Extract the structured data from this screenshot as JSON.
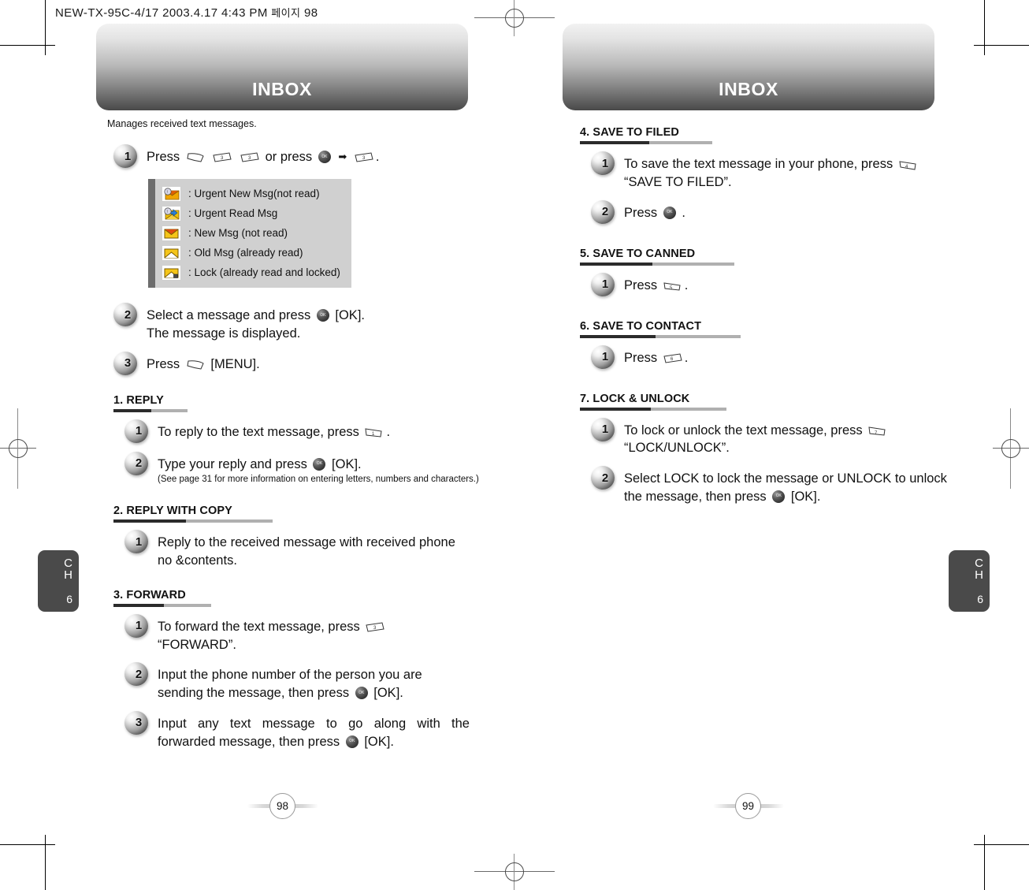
{
  "file_header": {
    "text": "NEW-TX-95C-4/17  2003.4.17 4:43 PM",
    "korean": "페이지",
    "page": "98"
  },
  "left_page": {
    "banner_title": "INBOX",
    "intro": "Manages received text messages.",
    "page_number": "98",
    "chapter": {
      "label": "CH",
      "number": "6"
    },
    "steps": [
      {
        "num": "1",
        "text_before": "Press",
        "text_after": "."
      }
    ],
    "legend": [
      {
        "icon": "urgent-new-msg-icon",
        "label": ": Urgent New Msg(not read)"
      },
      {
        "icon": "urgent-read-msg-icon",
        "label": ": Urgent Read Msg"
      },
      {
        "icon": "new-msg-icon",
        "label": ": New Msg (not read)"
      },
      {
        "icon": "old-msg-icon",
        "label": ": Old Msg (already read)"
      },
      {
        "icon": "lock-msg-icon",
        "label": ": Lock (already read and locked)"
      }
    ],
    "step2": {
      "num": "2",
      "line1a": "Select a message and press",
      "line1b": "[OK].",
      "line2": "The message is displayed."
    },
    "step3": {
      "num": "3",
      "before": "Press",
      "after": "[MENU]."
    },
    "sections": [
      {
        "title": "1. REPLY",
        "steps": [
          {
            "num": "1",
            "before": "To reply to the text message, press",
            "after": "."
          },
          {
            "num": "2",
            "before": "Type your reply and press",
            "after": "[OK].",
            "note": "(See page 31 for more information on entering letters, numbers and characters.)"
          }
        ]
      },
      {
        "title": "2. REPLY WITH COPY",
        "steps": [
          {
            "num": "1",
            "before": "Reply to the received message with received phone no &contents.",
            "after": ""
          }
        ]
      },
      {
        "title": "3. FORWARD",
        "steps": [
          {
            "num": "1",
            "before": "To forward the text message, press",
            "after": "“FORWARD”."
          },
          {
            "num": "2",
            "before": "Input the phone number of the person you are sending the message, then press",
            "after": "[OK]."
          },
          {
            "num": "3",
            "before": "Input any text message to go along with the forwarded message, then press",
            "after": "[OK]."
          }
        ]
      }
    ]
  },
  "right_page": {
    "banner_title": "INBOX",
    "page_number": "99",
    "chapter": {
      "label": "CH",
      "number": "6"
    },
    "sections": [
      {
        "title": "4. SAVE TO FILED",
        "steps": [
          {
            "num": "1",
            "before": "To save the text message in your phone, press",
            "after": "“SAVE TO FILED”."
          },
          {
            "num": "2",
            "before": "Press",
            "after": "."
          }
        ]
      },
      {
        "title": "5. SAVE TO CANNED",
        "steps": [
          {
            "num": "1",
            "before": "Press",
            "after": "."
          }
        ]
      },
      {
        "title": "6. SAVE TO CONTACT",
        "steps": [
          {
            "num": "1",
            "before": "Press",
            "after": "."
          }
        ]
      },
      {
        "title": "7. LOCK & UNLOCK",
        "steps": [
          {
            "num": "1",
            "before": "To lock or unlock the text message, press",
            "after": "“LOCK/UNLOCK”."
          },
          {
            "num": "2",
            "before": "Select LOCK to lock the message or UNLOCK to unlock the message, then press",
            "after": "[OK]."
          }
        ]
      }
    ]
  },
  "colors": {
    "banner_dark": "#494949",
    "legend_bg": "#d0d0d0",
    "legend_bar": "#6d6d6d",
    "chapter_tab": "#4a4a4a",
    "rule_dark": "#2b2b2b",
    "rule_light": "#b0b0b0",
    "envelope": "#f5c518"
  }
}
